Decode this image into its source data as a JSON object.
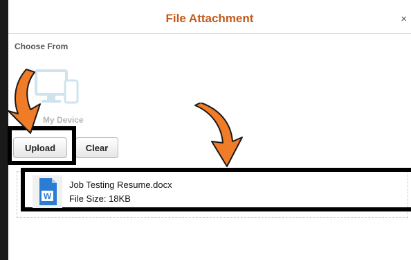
{
  "dialog": {
    "title": "File Attachment",
    "close_glyph": "×"
  },
  "choose_from": "Choose From",
  "device": {
    "label": "My Device",
    "icon": "monitor-phone-icon"
  },
  "buttons": {
    "upload": "Upload",
    "clear": "Clear"
  },
  "file": {
    "name": "Job Testing Resume.docx",
    "size": "File Size: 18KB",
    "icon": "word-document-icon",
    "icon_letter": "W"
  },
  "colors": {
    "title": "#c25a1b",
    "arrow": "#f07c28",
    "highlight": "#000000",
    "word_blue": "#2b7cd3"
  }
}
